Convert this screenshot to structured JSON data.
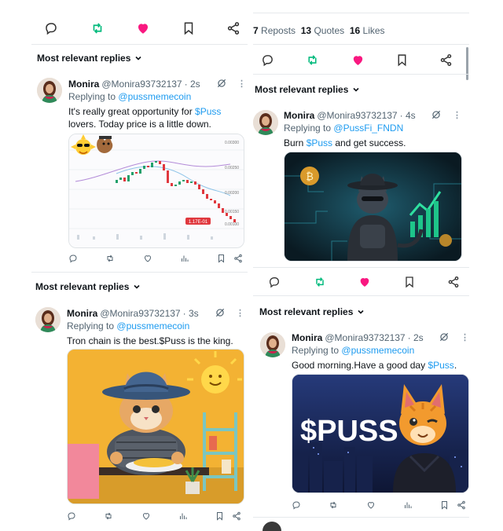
{
  "left_column": {
    "reply_header_1": "Most relevant replies",
    "tweet_1": {
      "name": "Monira",
      "handle": "@Monira93732137",
      "time": "· 2s",
      "replying_label": "Replying to",
      "replying_to": "@pussmemecoin",
      "text_line_1_a": "It's really great opportunity for ",
      "text_line_1_link": "$Puss",
      "text_line_2": "lovers. Today price is a little down.",
      "chart_price_label": "1.17E-01",
      "chart_right_labels": [
        "0.00300",
        "0.00250",
        "0.00200",
        "0.00150",
        "0.00100"
      ]
    },
    "reply_header_2": "Most relevant replies",
    "tweet_2": {
      "name": "Monira",
      "handle": "@Monira93732137",
      "time": "· 3s",
      "replying_label": "Replying to",
      "replying_to": "@pussmemecoin",
      "text": "Tron chain is the best.$Puss is the king."
    }
  },
  "right_column": {
    "stats": {
      "reposts_count": "7",
      "reposts_label": "Reposts",
      "quotes_count": "13",
      "quotes_label": "Quotes",
      "likes_count": "16",
      "likes_label": "Likes"
    },
    "reply_header_1": "Most relevant replies",
    "tweet_1": {
      "name": "Monira",
      "handle": "@Monira93732137",
      "time": "· 4s",
      "replying_label": "Replying to",
      "replying_to": "@PussFi_FNDN",
      "text_a": "Burn ",
      "text_link": "$Puss",
      "text_b": " and get success."
    },
    "reply_header_2": "Most relevant replies",
    "tweet_2": {
      "name": "Monira",
      "handle": "@Monira93732137",
      "time": "· 2s",
      "replying_label": "Replying to",
      "replying_to": "@pussmemecoin",
      "text_a": "Good morning.Have a good day ",
      "text_link": "$Puss",
      "text_b": ".",
      "image_text": "$PUSS"
    }
  },
  "colors": {
    "accent": "#1d9bf0",
    "like": "#f91880",
    "repost": "#00ba7c",
    "icon": "#536471"
  }
}
